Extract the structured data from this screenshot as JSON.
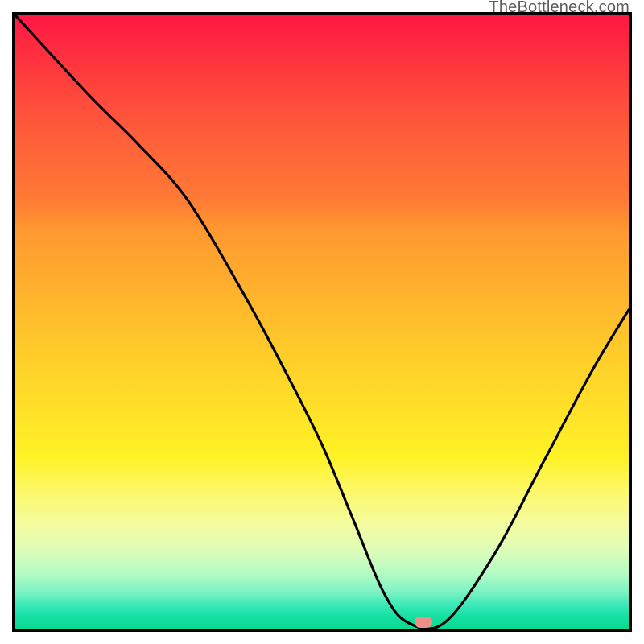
{
  "watermark": "TheBottleneck.com",
  "chart_data": {
    "type": "line",
    "title": "",
    "xlabel": "",
    "ylabel": "",
    "xlim": [
      0,
      100
    ],
    "ylim": [
      0,
      100
    ],
    "grid": false,
    "legend": false,
    "background": "vertical-gradient red→orange→yellow→green",
    "series": [
      {
        "name": "bottleneck-curve",
        "x": [
          0,
          12,
          20,
          28,
          37,
          44,
          50,
          55,
          60,
          64,
          70,
          78,
          86,
          94,
          100
        ],
        "values": [
          100,
          87,
          79,
          70,
          55,
          42,
          30,
          18,
          6,
          1,
          1,
          12,
          27,
          42,
          52
        ]
      }
    ],
    "marker": {
      "x": 66.5,
      "y": 1
    }
  }
}
